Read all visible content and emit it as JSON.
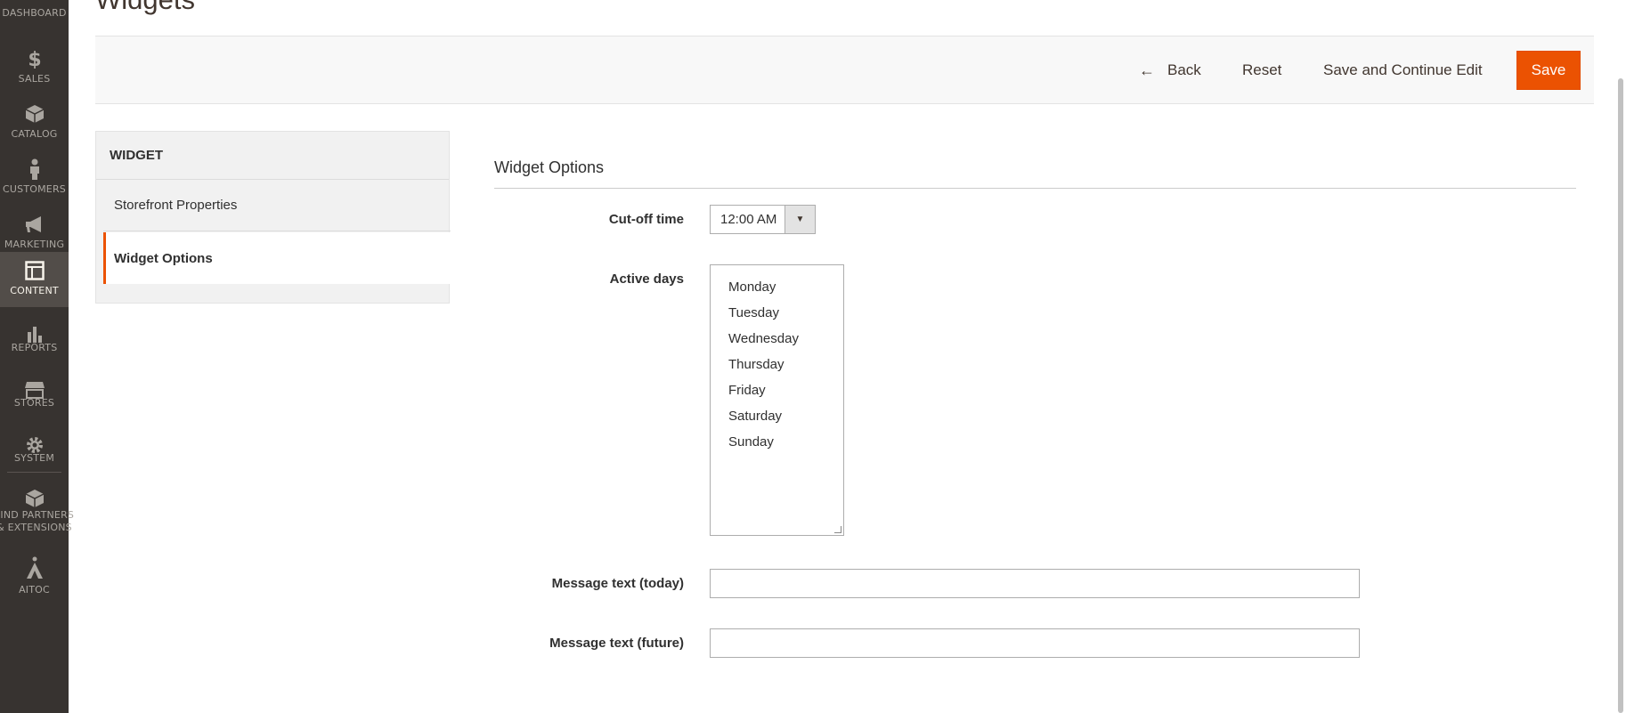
{
  "sidebar": {
    "items": [
      {
        "label": "DASHBOARD",
        "icon": "dashboard-icon"
      },
      {
        "label": "SALES",
        "icon": "dollar-icon"
      },
      {
        "label": "CATALOG",
        "icon": "cube-icon"
      },
      {
        "label": "CUSTOMERS",
        "icon": "person-icon"
      },
      {
        "label": "MARKETING",
        "icon": "megaphone-icon"
      },
      {
        "label": "CONTENT",
        "icon": "layout-icon",
        "active": true
      },
      {
        "label": "REPORTS",
        "icon": "bar-chart-icon"
      },
      {
        "label": "STORES",
        "icon": "store-icon"
      },
      {
        "label": "SYSTEM",
        "icon": "gear-icon"
      },
      {
        "label_line1": "FIND PARTNERS",
        "label_line2": "& EXTENSIONS",
        "icon": "boxes-icon"
      },
      {
        "label": "AITOC",
        "icon": "aitoc-logo-icon"
      }
    ]
  },
  "page": {
    "title": "Widgets"
  },
  "actions": {
    "back": "Back",
    "reset": "Reset",
    "save_continue": "Save and Continue Edit",
    "save": "Save"
  },
  "tabs": {
    "title": "WIDGET",
    "items": [
      {
        "label": "Storefront Properties"
      },
      {
        "label": "Widget Options",
        "active": true
      }
    ]
  },
  "form": {
    "section_title": "Widget Options",
    "cutoff_label": "Cut-off time",
    "cutoff_value": "12:00 AM",
    "active_days_label": "Active days",
    "days": [
      "Monday",
      "Tuesday",
      "Wednesday",
      "Thursday",
      "Friday",
      "Saturday",
      "Sunday"
    ],
    "msg_today_label": "Message text (today)",
    "msg_today_value": "",
    "msg_future_label": "Message text (future)",
    "msg_future_value": ""
  },
  "colors": {
    "accent": "#eb5202",
    "sidebar_bg": "#373330",
    "sidebar_active": "#524d49"
  }
}
